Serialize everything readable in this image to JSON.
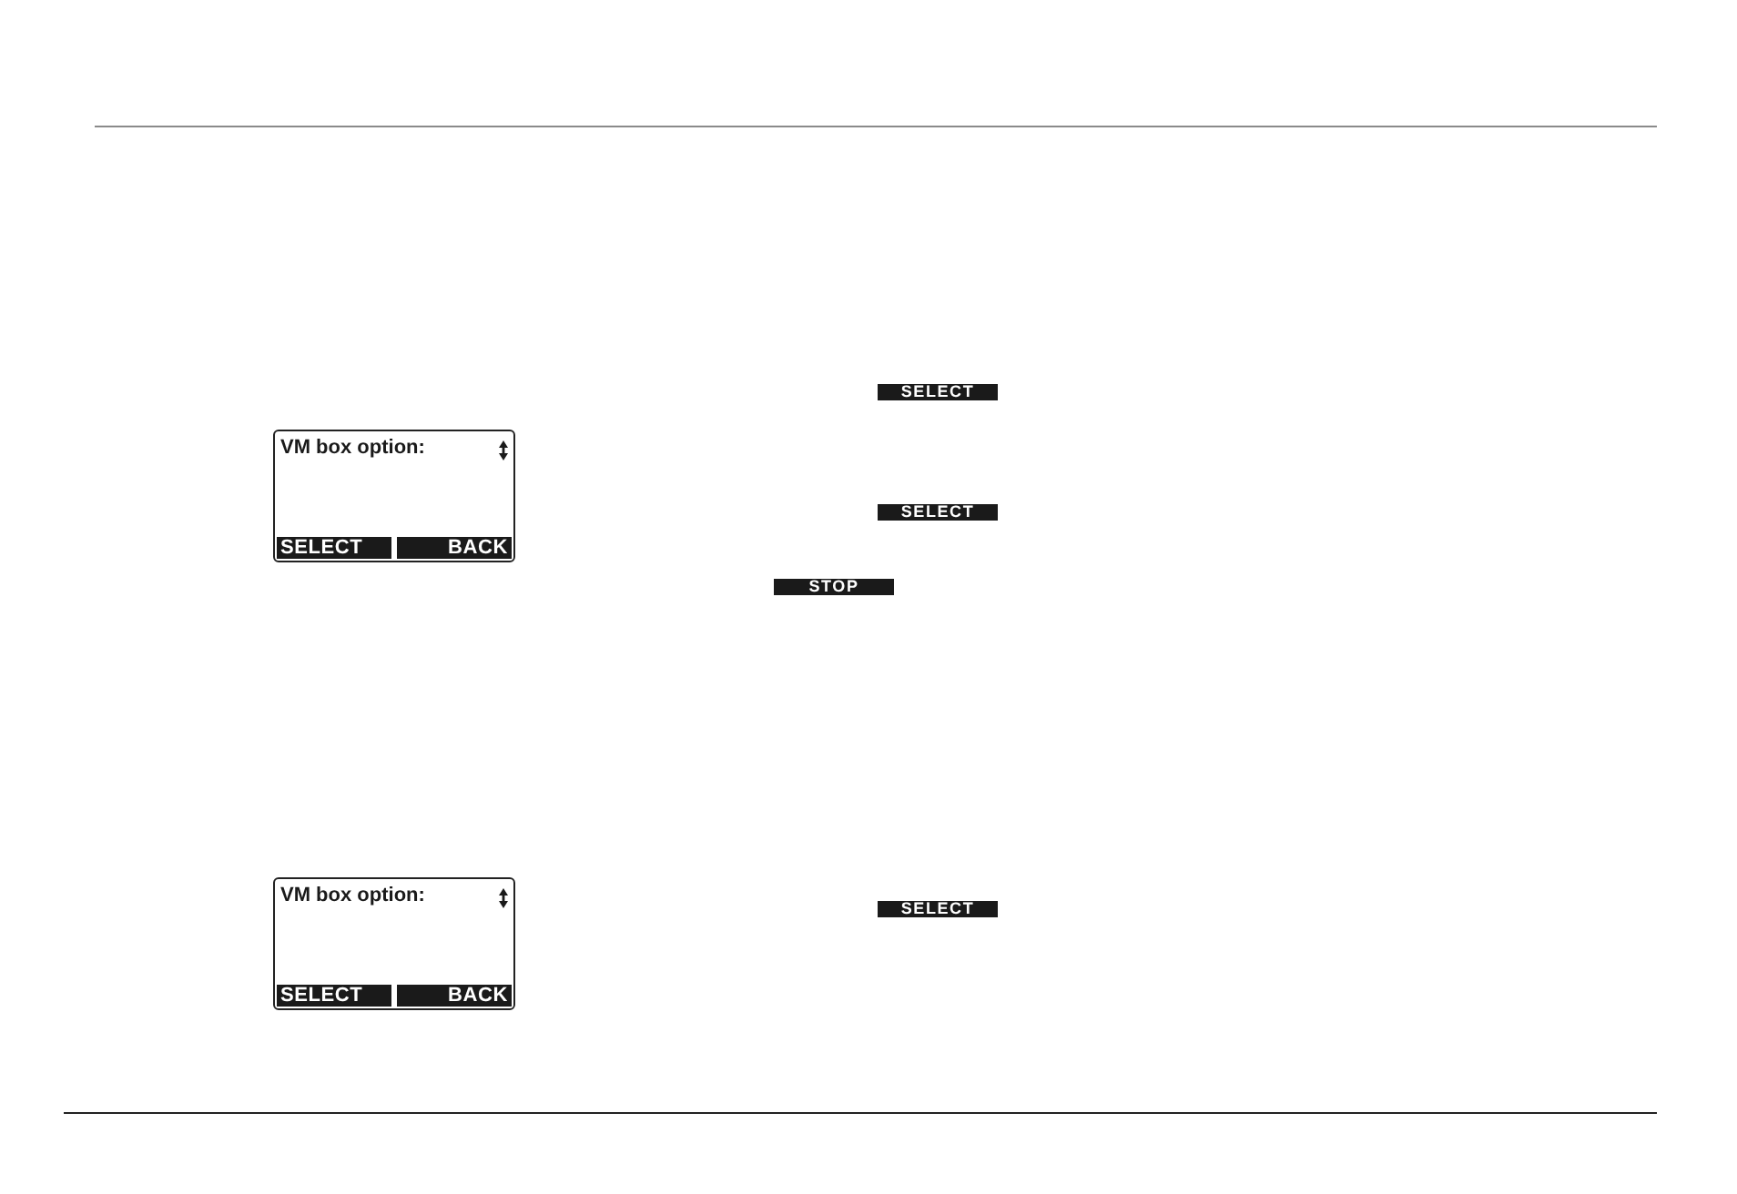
{
  "sections": [
    {
      "screen": {
        "title": "VM box option:",
        "softkeys": [
          "SELECT",
          "BACK"
        ]
      },
      "keys": [
        "SELECT",
        "SELECT",
        "STOP"
      ]
    },
    {
      "screen": {
        "title": "VM box option:",
        "softkeys": [
          "SELECT",
          "BACK"
        ]
      },
      "keys": [
        "SELECT"
      ]
    }
  ]
}
